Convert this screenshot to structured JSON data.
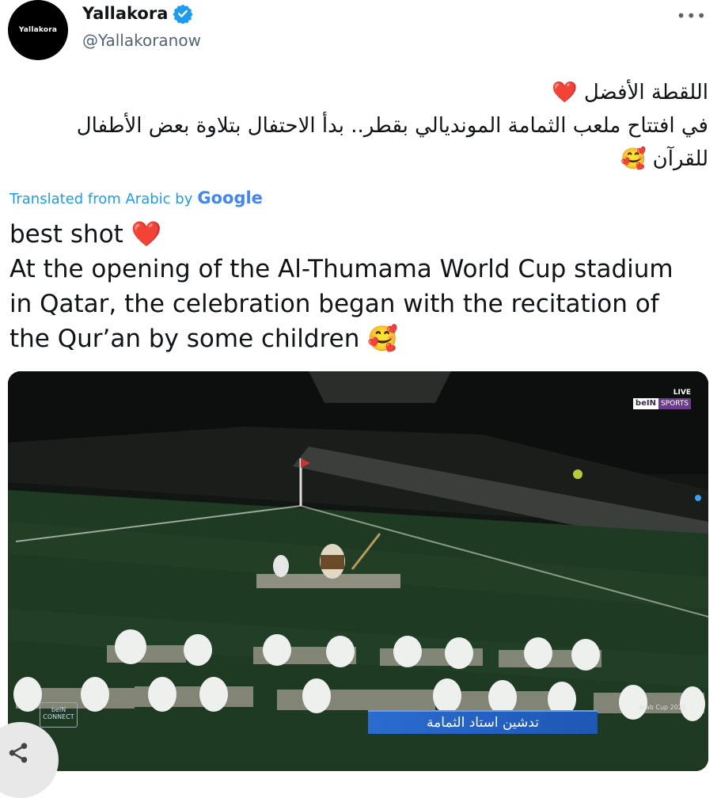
{
  "tweet": {
    "avatar_text": "Yallakora",
    "display_name": "Yallakora",
    "handle": "@Yallakoranow",
    "more_icon": "more-icon",
    "arabic_line1": "اللقطة الأفضل ❤️",
    "arabic_line2": "في افتتاح ملعب الثمامة المونديالي بقطر.. بدأ الاحتفال بتلاوة بعض الأطفال",
    "arabic_line3": "للقرآن 🥰",
    "translated_prefix": "Translated from Arabic by",
    "translated_provider": "Google",
    "english_line1": "best shot ❤️",
    "english_line2": "At the opening of the Al-Thumama World Cup stadium",
    "english_line3": "in Qatar, the celebration began with the recitation of",
    "english_line4": "the Qur’an by some children 🥰"
  },
  "media": {
    "live_label": "LIVE",
    "broadcaster_part1": "beIN",
    "broadcaster_part2": "SPORTS",
    "caption": "تدشين استاد الثمامة",
    "corner_logo": "beIN CONNECT",
    "cup_label": "Arab Cup 2021"
  },
  "colors": {
    "link": "#1d9bf0",
    "verified": "#1d9bf0",
    "secondary_text": "#536471",
    "pitch": "#1f3a22"
  }
}
